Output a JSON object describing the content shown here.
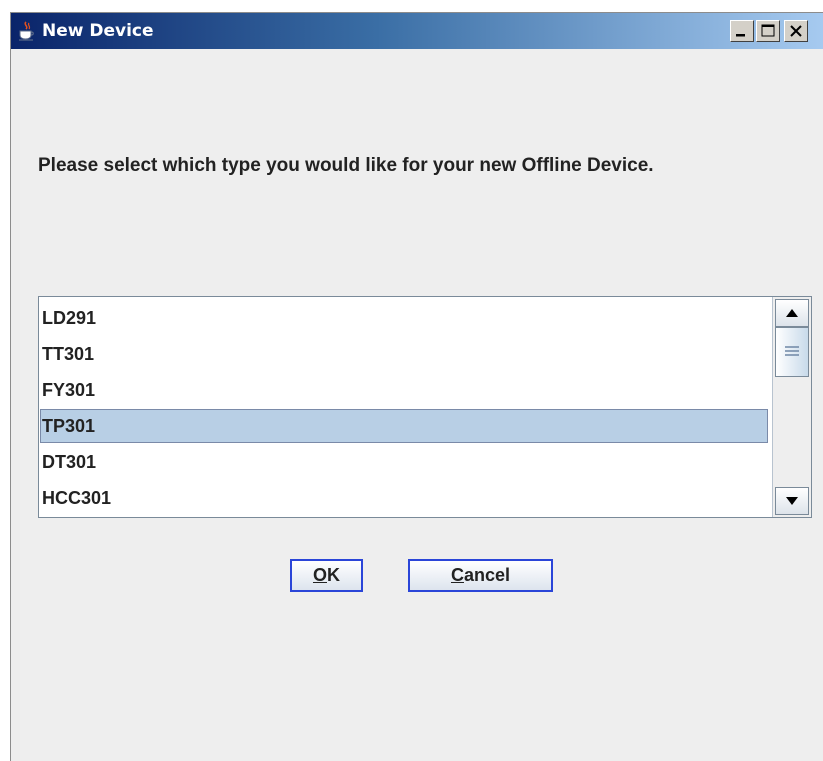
{
  "window": {
    "title": "New Device"
  },
  "prompt": {
    "text": "Please select which type you would like for your new Offline Device."
  },
  "device_list": {
    "items": [
      "LD291",
      "TT301",
      "FY301",
      "TP301",
      "DT301",
      "HCC301"
    ],
    "selected": "TP301"
  },
  "buttons": {
    "ok": {
      "mnemonic": "O",
      "rest": "K"
    },
    "cancel": {
      "mnemonic": "C",
      "rest": "ancel"
    }
  },
  "icons": {
    "app": "java-coffee-cup-icon",
    "minimize": "minimize-icon",
    "maximize": "maximize-icon",
    "close": "close-icon",
    "scroll_up": "arrow-up-icon",
    "scroll_down": "arrow-down-icon",
    "scroll_grip": "grip-lines-icon"
  },
  "colors": {
    "selection": "#b8cfe5",
    "button_border": "#2a45d8",
    "titlebar_start": "#0a246a",
    "titlebar_end": "#a6caf0"
  }
}
